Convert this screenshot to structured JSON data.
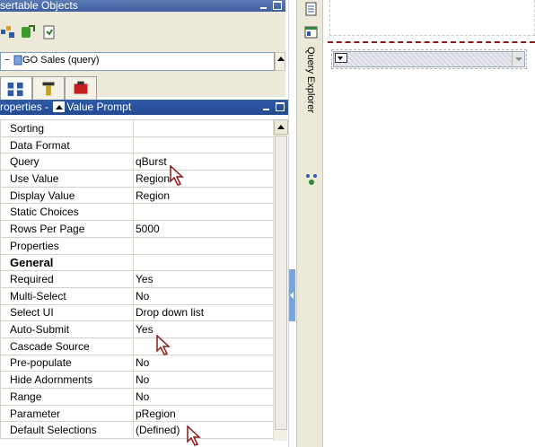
{
  "insertable_objects": {
    "title": "sertable Objects",
    "tree_item": "GO Sales (query)"
  },
  "properties_panel": {
    "title_prefix": "roperties - ",
    "title_object": "Value Prompt",
    "rows": [
      {
        "name": "Sorting",
        "value": ""
      },
      {
        "name": "Data Format",
        "value": ""
      },
      {
        "name": "Query",
        "value": "qBurst"
      },
      {
        "name": "Use Value",
        "value": "Region"
      },
      {
        "name": "Display Value",
        "value": "Region"
      },
      {
        "name": "Static Choices",
        "value": ""
      },
      {
        "name": "Rows Per Page",
        "value": "5000"
      },
      {
        "name": "Properties",
        "value": ""
      },
      {
        "name": "General",
        "value": "",
        "section": true
      },
      {
        "name": "Required",
        "value": "Yes"
      },
      {
        "name": "Multi-Select",
        "value": "No"
      },
      {
        "name": "Select UI",
        "value": "Drop down list"
      },
      {
        "name": "Auto-Submit",
        "value": "Yes"
      },
      {
        "name": "Cascade Source",
        "value": ""
      },
      {
        "name": "Pre-populate",
        "value": "No"
      },
      {
        "name": "Hide Adornments",
        "value": "No"
      },
      {
        "name": "Range",
        "value": "No"
      },
      {
        "name": "Parameter",
        "value": "pRegion"
      },
      {
        "name": "Default Selections",
        "value": "(Defined)"
      }
    ]
  },
  "side_strip": {
    "query_explorer_label": "Query Explorer"
  },
  "colors": {
    "header_blue": "#2f5aa8",
    "panel_bg": "#ece9d8",
    "canvas_separator": "#8a1a1a"
  }
}
